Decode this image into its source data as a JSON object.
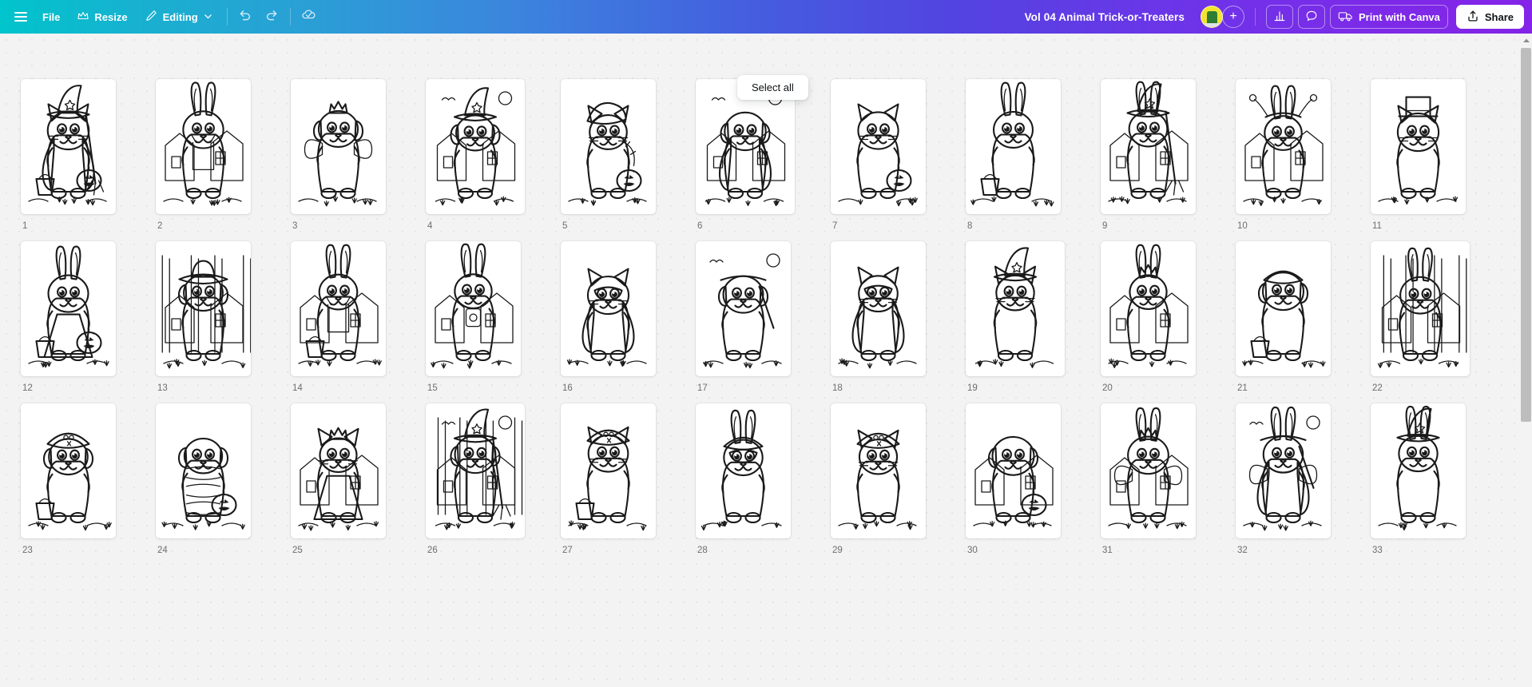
{
  "app": "Canva editor",
  "toolbar": {
    "menu_icon": "hamburger-menu-icon",
    "file_label": "File",
    "resize_label": "Resize",
    "resize_icon": "crown-icon",
    "editing_label": "Editing",
    "editing_icon": "pencil-icon",
    "editing_chevron": "chevron-down-icon",
    "undo_icon": "undo-arrow-icon",
    "redo_icon": "redo-arrow-icon",
    "cloud_saved_icon": "cloud-check-icon",
    "doc_title": "Vol 04 Animal Trick-or-Treaters",
    "avatar_name": "user-avatar",
    "add_member_label": "+",
    "insights_icon": "bar-chart-icon",
    "comments_icon": "speech-bubble-icon",
    "print_icon": "delivery-truck-icon",
    "print_label": "Print with Canva",
    "share_icon": "share-upload-icon",
    "share_label": "Share"
  },
  "canvas": {
    "select_all_label": "Select all",
    "scroll_up_icon": "scroll-up-arrow-icon"
  },
  "pages": [
    {
      "num": "1",
      "caption": "witch cat with cape, hat, broom and jack-o-lantern"
    },
    {
      "num": "2",
      "caption": "bunny farmer in overalls and straw hat by a house"
    },
    {
      "num": "3",
      "caption": "puppy fairy princess with crown, wand and wings"
    },
    {
      "num": "4",
      "caption": "puppy in witch hat in front of haunted house",
      "bleed": true
    },
    {
      "num": "5",
      "caption": "kitten in dinosaur costume holding pumpkin"
    },
    {
      "num": "6",
      "caption": "vampire puppy in doorway with moon",
      "bleed": true
    },
    {
      "num": "7",
      "caption": "fluffy kitten in cat hoodie with pumpkins"
    },
    {
      "num": "8",
      "caption": "kitten in bunny hood holding treat bag"
    },
    {
      "num": "9",
      "caption": "bunny witch with hat and broom by house"
    },
    {
      "num": "10",
      "caption": "bunny jester with bell hat and gingerbread house"
    },
    {
      "num": "11",
      "caption": "cat in top hat and tuxedo with spiderweb"
    },
    {
      "num": "12",
      "caption": "bunny with polka-dot dress holding pumpkin basket"
    },
    {
      "num": "13",
      "caption": "puppy cowboy with hat and bandana on street"
    },
    {
      "num": "14",
      "caption": "bunny in overalls with candy bag by house"
    },
    {
      "num": "15",
      "caption": "bunny astronaut robot costume by house"
    },
    {
      "num": "16",
      "caption": "kitten superhero with mask and cape"
    },
    {
      "num": "17",
      "caption": "puppy baseball player with cap and bat"
    },
    {
      "num": "18",
      "caption": "flying superhero kitten with mask and cape"
    },
    {
      "num": "19",
      "caption": "wizard kitten with starred hat and cloak",
      "bleed": true
    },
    {
      "num": "20",
      "caption": "bunny princess in archway doorway"
    },
    {
      "num": "21",
      "caption": "puppy firefighter with helmet and bucket"
    },
    {
      "num": "22",
      "caption": "bunny in village street scene",
      "bleed": true
    },
    {
      "num": "23",
      "caption": "pirate puppy with skull hat and treasure chest"
    },
    {
      "num": "24",
      "caption": "mummy puppy wrapped in bandages with pumpkin"
    },
    {
      "num": "25",
      "caption": "cat princess in gown with castle background"
    },
    {
      "num": "26",
      "caption": "puppy witch with broom in spooky forest",
      "bleed": true
    },
    {
      "num": "27",
      "caption": "pirate kitten with hat and lantern"
    },
    {
      "num": "28",
      "caption": "puppy pilot with goggles and bunny friend"
    },
    {
      "num": "29",
      "caption": "pirate cat with hook, sword and bandana"
    },
    {
      "num": "30",
      "caption": "puppy in window frame with pumpkin"
    },
    {
      "num": "31",
      "caption": "bunny fairy with flower crown by cottage"
    },
    {
      "num": "32",
      "caption": "bunny vampire with bat wings"
    },
    {
      "num": "33",
      "caption": "bunny witch with cloak and mushrooms"
    }
  ]
}
